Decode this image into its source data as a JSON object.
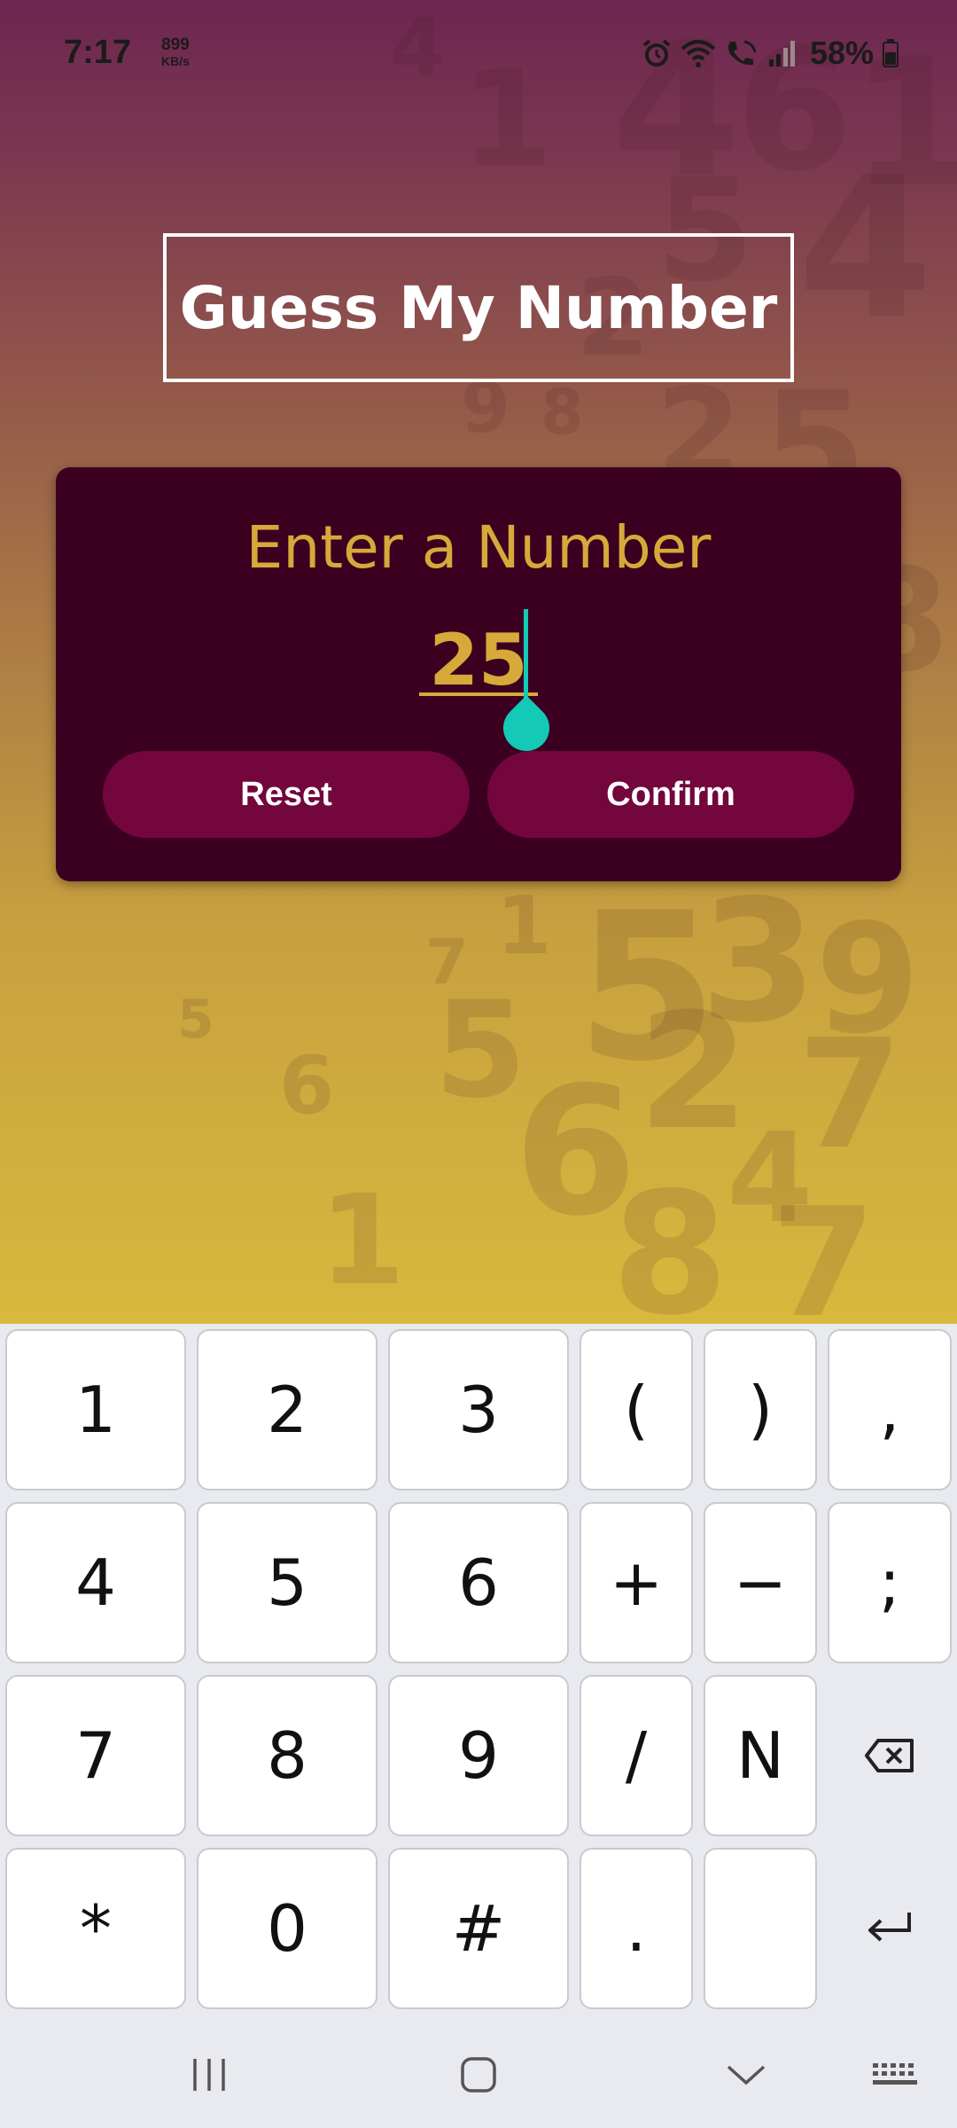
{
  "status_bar": {
    "time": "7:17",
    "net_speed_value": "899",
    "net_speed_unit": "KB/s",
    "battery_percent": "58%"
  },
  "app": {
    "title": "Guess My Number",
    "prompt_label": "Enter a Number",
    "input_value": "25",
    "reset_label": "Reset",
    "confirm_label": "Confirm"
  },
  "colors": {
    "accent_gold": "#d7a93a",
    "card_background": "#3b0020",
    "button_background": "#72063d",
    "cursor": "#14c9b5"
  },
  "keyboard": {
    "rows": [
      [
        "1",
        "2",
        "3",
        "(",
        ")",
        ","
      ],
      [
        "4",
        "5",
        "6",
        "+",
        "−",
        ";"
      ],
      [
        "7",
        "8",
        "9",
        "/",
        "N"
      ],
      [
        "*",
        "0",
        "#",
        ".",
        ""
      ]
    ],
    "special_icons": [
      "backspace-icon",
      "enter-icon"
    ]
  },
  "nav_bar": {
    "icons": [
      "recent-apps-icon",
      "home-icon",
      "back-icon",
      "keyboard-switch-icon"
    ]
  }
}
